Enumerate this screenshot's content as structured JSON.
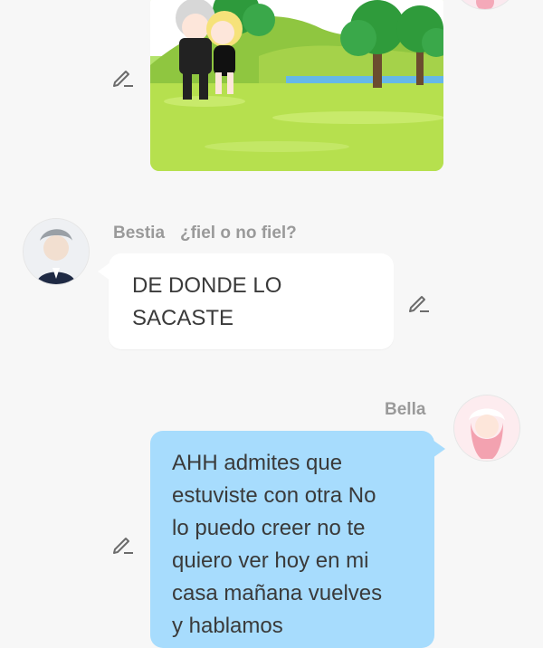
{
  "chat": {
    "messages": [
      {
        "type": "image",
        "sender": "other",
        "image_alt": "gacha-characters-park-image"
      },
      {
        "type": "text",
        "sender": "Bestia",
        "title": "¿fiel o no fiel?",
        "text": "DE DONDE LO\nSACASTE"
      },
      {
        "type": "text",
        "sender": "Bella",
        "text": "AHH admites que\nestuviste con otra No\nlo puedo creer no te\nquiero ver hoy en mi\ncasa mañana vuelves\ny hablamos"
      }
    ]
  },
  "icons": {
    "edit": "pencil-icon"
  },
  "colors": {
    "background": "#f7f7f7",
    "incoming_bubble": "#ffffff",
    "outgoing_bubble": "#a7dcfd",
    "name_text": "#9a9a9a",
    "message_text": "#3a3a3a"
  }
}
